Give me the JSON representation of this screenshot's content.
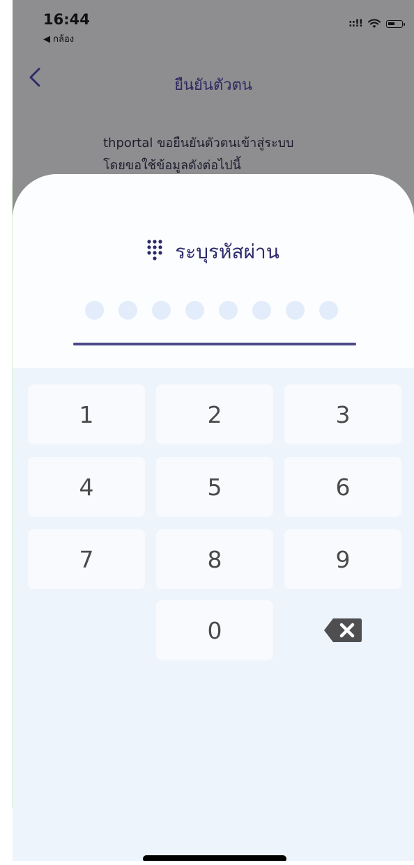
{
  "status_bar": {
    "time": "16:44",
    "back_app": "◀ กล้อง",
    "signal": "::!!"
  },
  "nav": {
    "title": "ยืนยันตัวตน"
  },
  "consent": {
    "line1": "thportal ขอยืนยันตัวตนเข้าสู่ระบบ",
    "line2": "โดยขอใช้ข้อมูลดังต่อไปนี้"
  },
  "pin_entry": {
    "label": "ระบุรหัสผ่าน",
    "length": 8,
    "entered": 0
  },
  "keypad": {
    "keys": [
      "1",
      "2",
      "3",
      "4",
      "5",
      "6",
      "7",
      "8",
      "9",
      "0"
    ],
    "delete_icon": "backspace-icon"
  },
  "colors": {
    "accent": "#2e2a6a",
    "underline": "#4a4888",
    "dot": "#e3ecfa",
    "sheet_bg": "#eef4fc",
    "key_bg": "#f8fafd"
  }
}
